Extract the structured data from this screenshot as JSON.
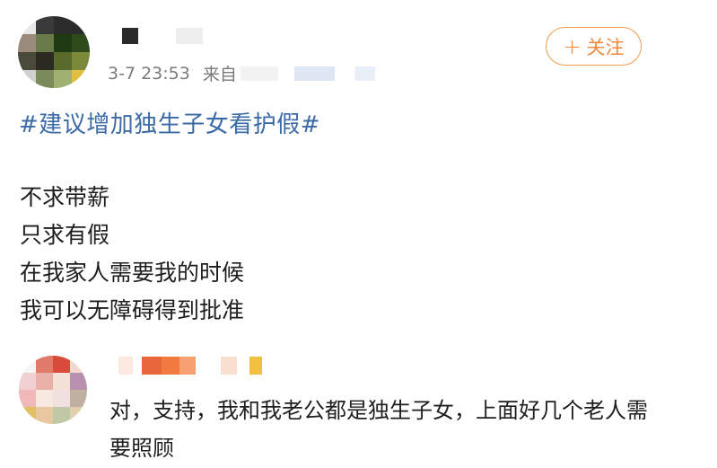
{
  "post": {
    "timestamp": "3-7 23:53",
    "source_prefix": "来自",
    "follow_label": "关注",
    "follow_icon": "plus-icon",
    "topic": "#建议增加独生子女看护假#",
    "lines": [
      "不求带薪",
      "只求有假",
      "在我家人需要我的时候",
      "我可以无障碍得到批准"
    ]
  },
  "comment": {
    "text": "对，支持，我和我老公都是独生子女，上面好几个老人需要照顾"
  },
  "colors": {
    "accent_orange": "#f0883a",
    "topic_blue": "#3b6aa6",
    "meta_gray": "#7a7a7a"
  }
}
